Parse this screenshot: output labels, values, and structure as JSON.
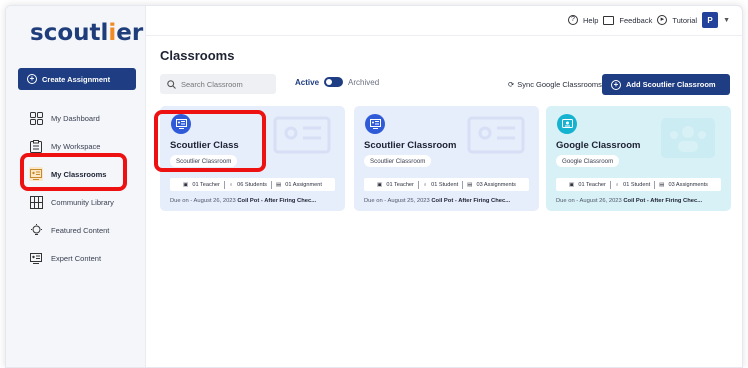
{
  "app": {
    "logo_text_pre": "scoutl",
    "logo_text_i": "i",
    "logo_text_post": "er"
  },
  "sidebar": {
    "create_label": "Create Assignment",
    "items": [
      {
        "label": "My Dashboard",
        "icon": "grid-icon",
        "active": false
      },
      {
        "label": "My Workspace",
        "icon": "clipboard-icon",
        "active": false
      },
      {
        "label": "My Classrooms",
        "icon": "classroom-board-icon",
        "active": true
      },
      {
        "label": "Community Library",
        "icon": "library-icon",
        "active": false
      },
      {
        "label": "Featured Content",
        "icon": "featured-bulb-icon",
        "active": false
      },
      {
        "label": "Expert Content",
        "icon": "expert-board-icon",
        "active": false
      }
    ]
  },
  "topbar": {
    "help": "Help",
    "feedback": "Feedback",
    "tutorial": "Tutorial",
    "avatar_initial": "P"
  },
  "main": {
    "title": "Classrooms",
    "search_placeholder": "Search Classroom",
    "toggle_active": "Active",
    "toggle_archived": "Archived",
    "sync_label": "Sync Google Classrooms",
    "add_label": "Add Scoutlier Classroom"
  },
  "cards": [
    {
      "title": "Scoutlier Class",
      "subtitle": "Scoutlier Classroom",
      "teachers": "01 Teacher",
      "students": "06 Students",
      "assignments": "01 Assignment",
      "due_prefix": "Due on - August 26, 2023",
      "due_task": "Coil Pot - After Firing Chec..."
    },
    {
      "title": "Scoutlier Classroom",
      "subtitle": "Scoutlier Classroom",
      "teachers": "01 Teacher",
      "students": "01 Student",
      "assignments": "03 Assignments",
      "due_prefix": "Due on - August 25, 2023",
      "due_task": "Coil Pot - After Firing Chec..."
    },
    {
      "title": "Google Classroom",
      "subtitle": "Google Classroom",
      "teachers": "01 Teacher",
      "students": "01 Student",
      "assignments": "03 Assignments",
      "due_prefix": "Due on - August 26, 2023",
      "due_task": "Coil Pot - After Firing Chec..."
    }
  ],
  "colors": {
    "brand": "#1f3d82",
    "logo_accent": "#f08a24",
    "highlight": "#ee1111"
  }
}
